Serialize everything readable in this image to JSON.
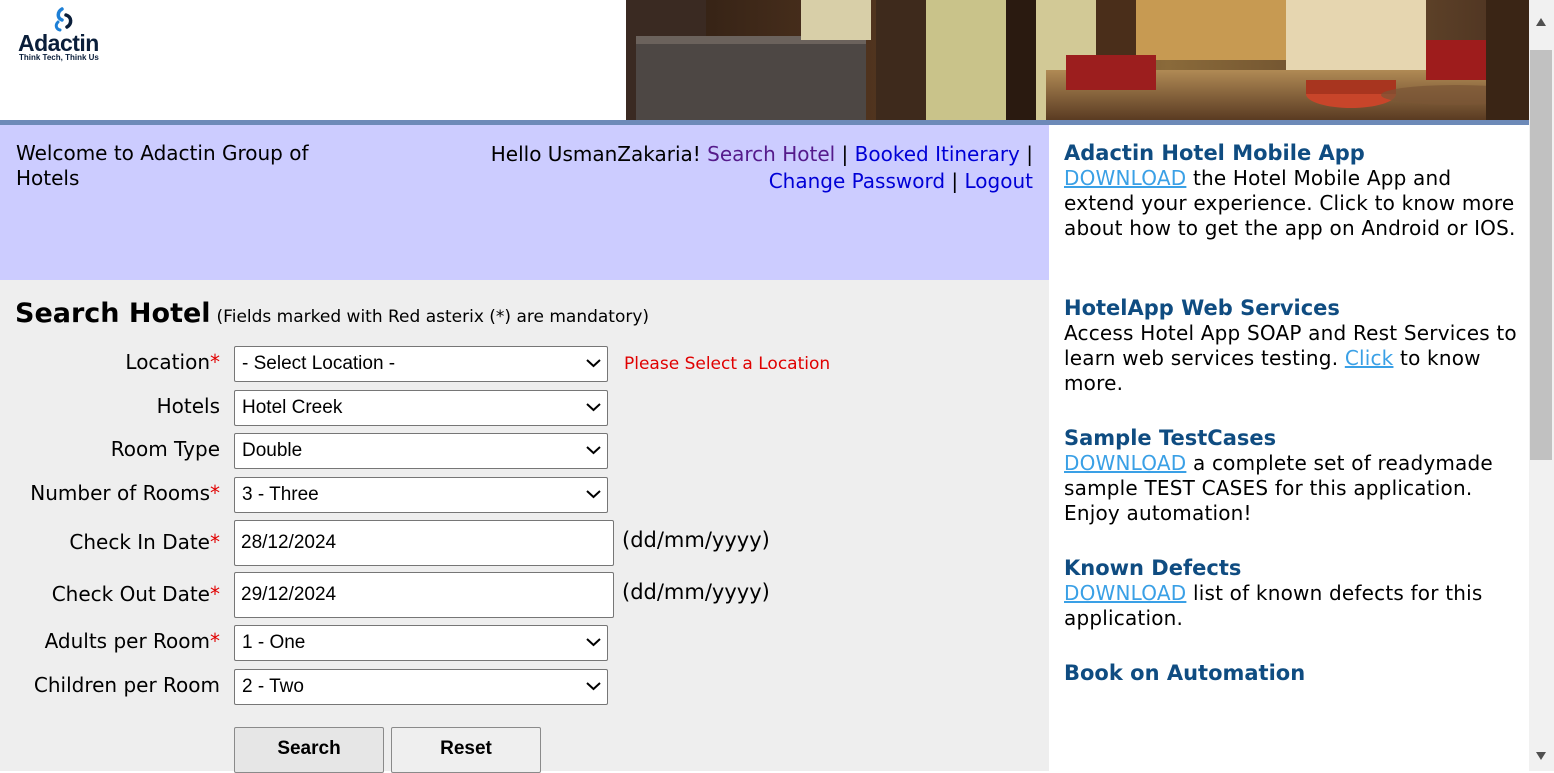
{
  "brand": {
    "name": "Adactin",
    "tagline": "Think Tech, Think Us"
  },
  "welcome": "Welcome to Adactin Group of Hotels",
  "user_nav": {
    "greeting": "Hello UsmanZakaria!",
    "search_hotel": "Search Hotel",
    "booked_itinerary": "Booked Itinerary",
    "change_password": "Change Password",
    "logout": "Logout",
    "separator": "|"
  },
  "form": {
    "title": "Search Hotel",
    "note": "(Fields marked with Red asterix (*) are mandatory)",
    "required_mark": "*",
    "location": {
      "label": "Location",
      "value": "- Select Location -",
      "error": "Please Select a Location"
    },
    "hotels": {
      "label": "Hotels",
      "value": "Hotel Creek"
    },
    "room_type": {
      "label": "Room Type",
      "value": "Double"
    },
    "rooms": {
      "label": "Number of Rooms",
      "value": "3 - Three"
    },
    "check_in": {
      "label": "Check In Date",
      "value": "28/12/2024",
      "format": "(dd/mm/yyyy)"
    },
    "check_out": {
      "label": "Check Out Date",
      "value": "29/12/2024",
      "format": "(dd/mm/yyyy)"
    },
    "adults": {
      "label": "Adults per Room",
      "value": "1 - One"
    },
    "children": {
      "label": "Children per Room",
      "value": "2 - Two"
    },
    "search_button": "Search",
    "reset_button": "Reset"
  },
  "aside": {
    "mobile": {
      "title": "Adactin Hotel Mobile App",
      "link": "DOWNLOAD",
      "text": " the Hotel Mobile App and extend your experience. Click to know more about how to get the app on Android or IOS."
    },
    "web_services": {
      "title": "HotelApp Web Services",
      "text_before": "Access Hotel App SOAP and Rest Services to learn web services testing. ",
      "link": "Click",
      "text_after": " to know more."
    },
    "testcases": {
      "title": "Sample TestCases",
      "link": "DOWNLOAD",
      "text": " a complete set of readymade sample TEST CASES for this application. Enjoy automation!"
    },
    "defects": {
      "title": "Known Defects",
      "link": "DOWNLOAD",
      "text": " list of known defects for this application."
    },
    "book": {
      "title": "Book on Automation"
    }
  },
  "colors": {
    "header_band": "#ccccff",
    "form_bg": "#eeeeee",
    "required": "#e00000",
    "aside_heading": "#0f4c81",
    "aside_link": "#3aa0e6"
  }
}
